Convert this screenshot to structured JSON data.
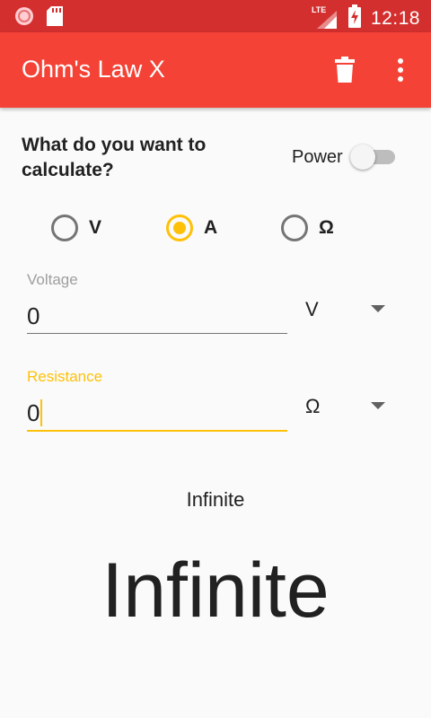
{
  "status_bar": {
    "time": "12:18",
    "network_label": "LTE",
    "icons": [
      "notification-icon",
      "sd-card-icon",
      "signal-icon",
      "battery-charging-icon"
    ]
  },
  "app_bar": {
    "title": "Ohm's Law X",
    "actions": [
      "delete-icon",
      "overflow-menu-icon"
    ]
  },
  "form": {
    "question": "What do you want to calculate?",
    "power_label": "Power",
    "power_enabled": false,
    "options": [
      {
        "label": "V",
        "selected": false
      },
      {
        "label": "A",
        "selected": true
      },
      {
        "label": "Ω",
        "selected": false
      }
    ],
    "voltage": {
      "label": "Voltage",
      "value": "0",
      "unit": "V"
    },
    "resistance": {
      "label": "Resistance",
      "value": "0",
      "unit": "Ω",
      "focused": true
    }
  },
  "result": {
    "small": "Infinite",
    "large": "Infinite"
  },
  "colors": {
    "status_bar": "#D32F2F",
    "app_bar": "#F44336",
    "accent": "#FFC107"
  }
}
